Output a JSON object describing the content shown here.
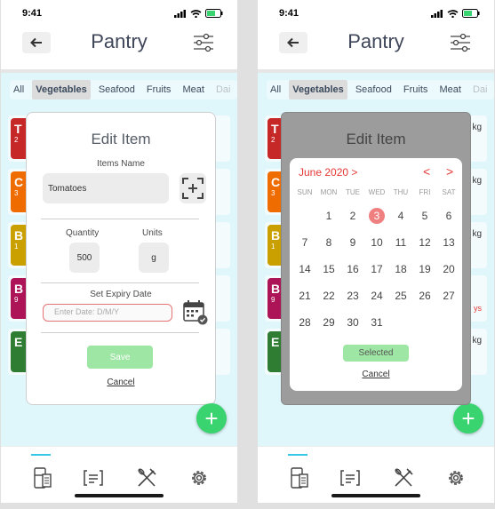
{
  "status": {
    "time": "9:41"
  },
  "header": {
    "title": "Pantry"
  },
  "categories": [
    "All",
    "Vegetables",
    "Seafood",
    "Fruits",
    "Meat",
    "Dai"
  ],
  "items": [
    {
      "letter": "T",
      "sub": "2",
      "color": "#c62828"
    },
    {
      "letter": "C",
      "sub": "3",
      "color": "#ef6c00"
    },
    {
      "letter": "B",
      "sub": "1",
      "color": "#c9a000"
    },
    {
      "letter": "B",
      "sub": "9",
      "color": "#ad1457"
    },
    {
      "letter": "E",
      "sub": "",
      "color": "#2e7d32"
    }
  ],
  "row_right_texts": [
    "kg",
    "kg",
    "kg",
    "kg"
  ],
  "row_days_text": "ys",
  "modal": {
    "title": "Edit Item",
    "name_label": "Items Name",
    "name_value": "Tomatoes",
    "quantity_label": "Quantity",
    "quantity_value": "500",
    "units_label": "Units",
    "units_value": "g",
    "expiry_label": "Set Expiry Date",
    "date_placeholder": "Enter Date: D/M/Y",
    "save_label": "Save",
    "cancel_label": "Cancel"
  },
  "calendar": {
    "month": "June 2020",
    "month_arrow": ">",
    "prev": "<",
    "next": ">",
    "weekdays": [
      "SUN",
      "MON",
      "TUE",
      "WED",
      "THU",
      "FRI",
      "SAT"
    ],
    "weeks": [
      [
        "",
        "1",
        "2",
        "3",
        "4",
        "5",
        "6"
      ],
      [
        "7",
        "8",
        "9",
        "10",
        "11",
        "12",
        "13"
      ],
      [
        "14",
        "15",
        "16",
        "17",
        "18",
        "19",
        "20"
      ],
      [
        "21",
        "22",
        "23",
        "24",
        "25",
        "26",
        "27"
      ],
      [
        "28",
        "29",
        "30",
        "31",
        "",
        "",
        ""
      ]
    ],
    "selected_day": "3",
    "selected_label": "Selected",
    "cancel_label": "Cancel"
  },
  "fab_label": "+",
  "colors": {
    "accent": "#35c7e8",
    "fab": "#39d36f",
    "save": "#9ee6a4",
    "danger": "#e53935"
  }
}
